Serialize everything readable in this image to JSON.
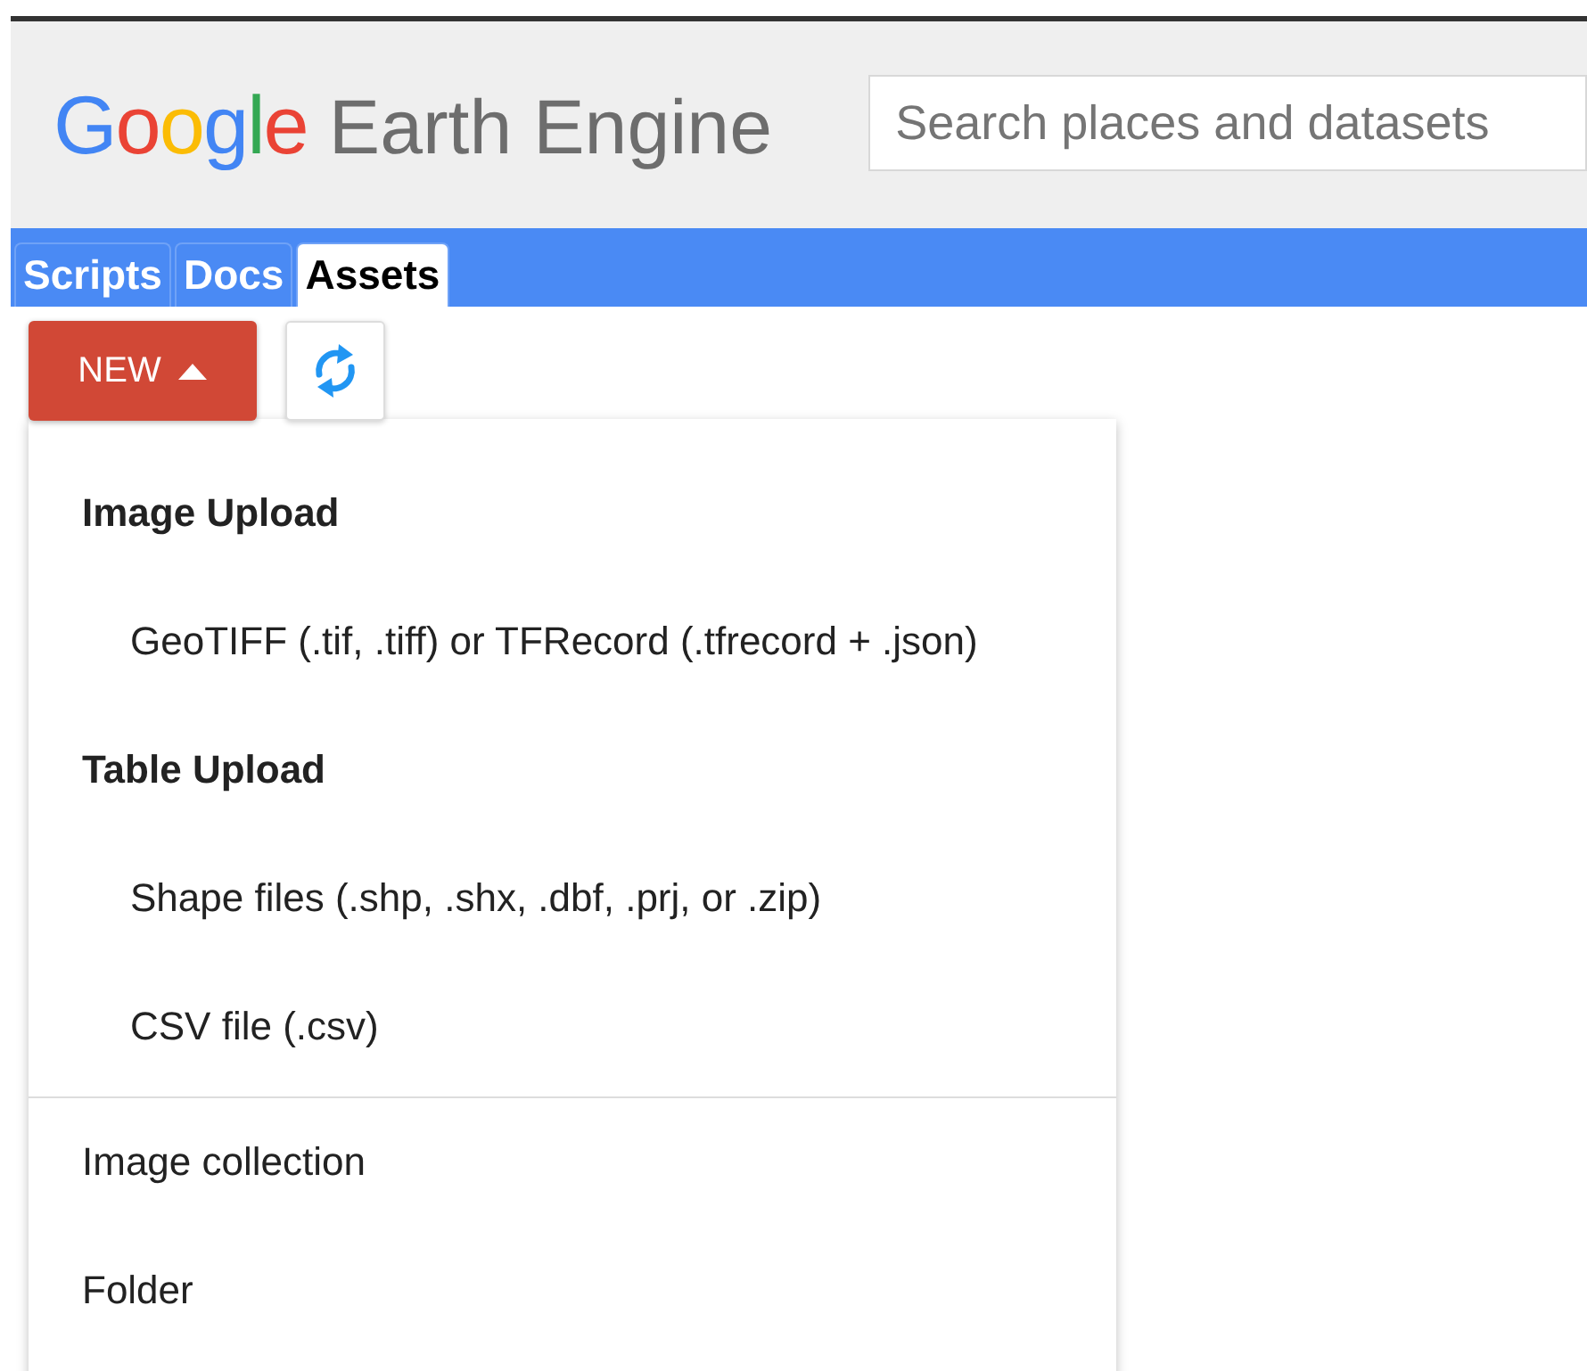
{
  "header": {
    "logo_brand": "Google",
    "logo_product": "Earth Engine",
    "search": {
      "placeholder": "Search places and datasets"
    }
  },
  "tabs": [
    {
      "label": "Scripts",
      "selected": false
    },
    {
      "label": "Docs",
      "selected": false
    },
    {
      "label": "Assets",
      "selected": true
    }
  ],
  "toolbar": {
    "new_button": "NEW"
  },
  "menu": {
    "sections": [
      {
        "items": [
          {
            "kind": "header",
            "label": "Image Upload"
          },
          {
            "kind": "option",
            "label": "GeoTIFF (.tif, .tiff) or TFRecord (.tfrecord + .json)"
          },
          {
            "kind": "header",
            "label": "Table Upload"
          },
          {
            "kind": "option",
            "label": "Shape files (.shp, .shx, .dbf, .prj, or .zip)"
          },
          {
            "kind": "option",
            "label": "CSV file (.csv)"
          }
        ]
      },
      {
        "items": [
          {
            "kind": "action",
            "label": "Image collection"
          },
          {
            "kind": "action",
            "label": "Folder"
          }
        ]
      }
    ]
  }
}
